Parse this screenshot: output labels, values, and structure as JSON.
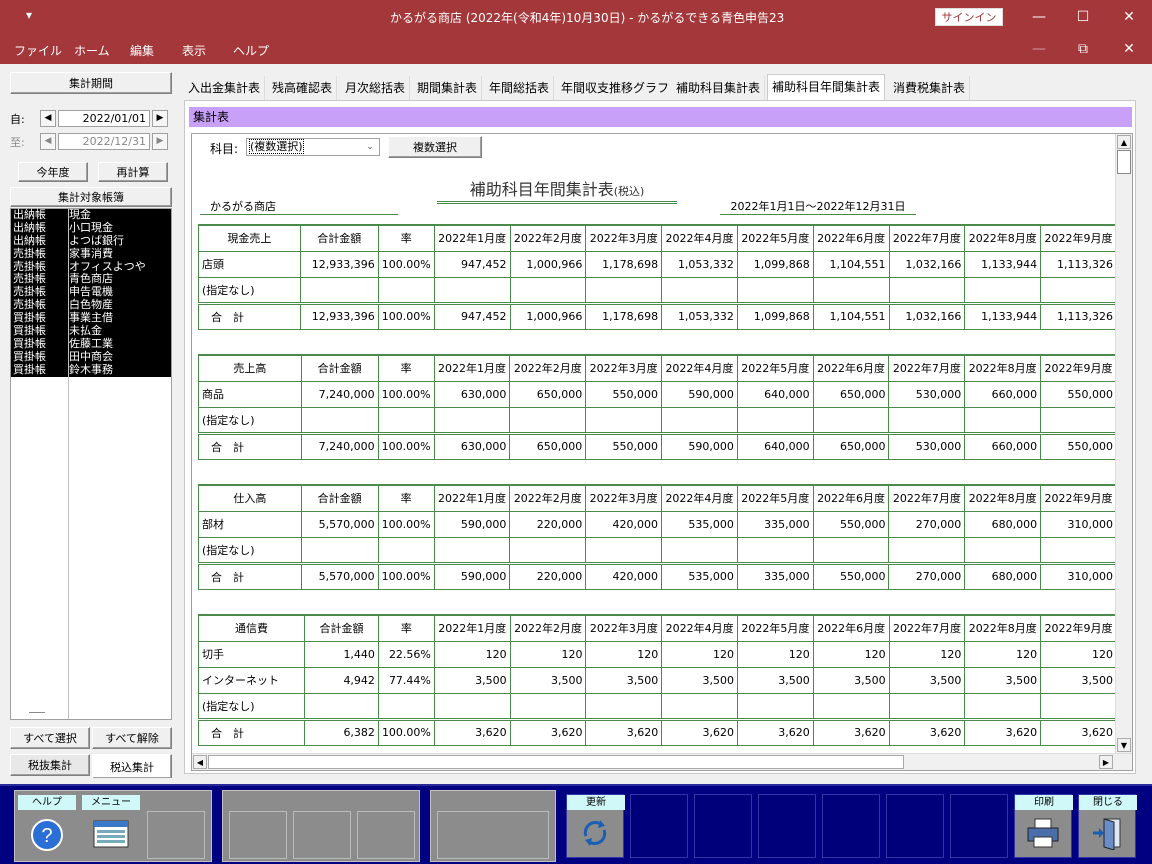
{
  "window": {
    "title": "かるがる商店 (2022年(令和4年)10月30日)  -  かるがるできる青色申告23",
    "signin_label": "サインイン",
    "menu_glyph": "▾"
  },
  "menu": [
    "ファイル",
    "ホーム",
    "編集",
    "表示",
    "ヘルプ"
  ],
  "left_panel": {
    "period_button": "集計期間",
    "from_label": "自:",
    "from_date": "2022/01/01",
    "to_label": "至:",
    "to_date": "2022/12/31",
    "this_year_button": "今年度",
    "recalc_button": "再計算",
    "target_ledger_header": "集計対象帳簿",
    "ledgers": [
      {
        "book": "出納帳",
        "name": "現金"
      },
      {
        "book": "出納帳",
        "name": "小口現金"
      },
      {
        "book": "出納帳",
        "name": "よつば銀行"
      },
      {
        "book": "売掛帳",
        "name": "家事消費"
      },
      {
        "book": "売掛帳",
        "name": "オフィスよつや"
      },
      {
        "book": "売掛帳",
        "name": "青色商店"
      },
      {
        "book": "売掛帳",
        "name": "申告電機"
      },
      {
        "book": "売掛帳",
        "name": "白色物産"
      },
      {
        "book": "買掛帳",
        "name": "事業主借"
      },
      {
        "book": "買掛帳",
        "name": "未払金"
      },
      {
        "book": "買掛帳",
        "name": "佐藤工業"
      },
      {
        "book": "買掛帳",
        "name": "田中商会"
      },
      {
        "book": "買掛帳",
        "name": "鈴木事務"
      }
    ],
    "select_all_button": "すべて選択",
    "deselect_all_button": "すべて解除",
    "tax_excl_button": "税抜集計",
    "tax_incl_button": "税込集計"
  },
  "tabs": [
    "入出金集計表",
    "残高確認表",
    "月次総括表",
    "期間集計表",
    "年間総括表",
    "年間収支推移グラフ",
    "補助科目集計表",
    "補助科目年間集計表",
    "消費税集計表"
  ],
  "active_tab": "補助科目年間集計表",
  "section_label": "集計表",
  "filter": {
    "label": "科目:",
    "value": "(複数選択)",
    "multi_button": "複数選択"
  },
  "report": {
    "title": "補助科目年間集計表",
    "title_suffix": "(税込)",
    "company": "かるがる商店",
    "period": "2022年1月1日～2022年12月31日",
    "col_total": "合計金額",
    "col_rate": "率",
    "months": [
      "2022年1月度",
      "2022年2月度",
      "2022年3月度",
      "2022年4月度",
      "2022年5月度",
      "2022年6月度",
      "2022年7月度",
      "2022年8月度",
      "2022年9月度"
    ],
    "sections": [
      {
        "account": "現金売上",
        "rows": [
          {
            "name": "店頭",
            "total": "12,933,396",
            "rate": "100.00%",
            "values": [
              "947,452",
              "1,000,966",
              "1,178,698",
              "1,053,332",
              "1,099,868",
              "1,104,551",
              "1,032,166",
              "1,133,944",
              "1,113,326"
            ]
          },
          {
            "name": "(指定なし)",
            "total": "",
            "rate": "",
            "values": [
              "",
              "",
              "",
              "",
              "",
              "",
              "",
              "",
              ""
            ]
          }
        ],
        "sum": {
          "name": "合　計",
          "total": "12,933,396",
          "rate": "100.00%",
          "values": [
            "947,452",
            "1,000,966",
            "1,178,698",
            "1,053,332",
            "1,099,868",
            "1,104,551",
            "1,032,166",
            "1,133,944",
            "1,113,326"
          ]
        }
      },
      {
        "account": "売上高",
        "rows": [
          {
            "name": "商品",
            "total": "7,240,000",
            "rate": "100.00%",
            "values": [
              "630,000",
              "650,000",
              "550,000",
              "590,000",
              "640,000",
              "650,000",
              "530,000",
              "660,000",
              "550,000"
            ]
          },
          {
            "name": "(指定なし)",
            "total": "",
            "rate": "",
            "values": [
              "",
              "",
              "",
              "",
              "",
              "",
              "",
              "",
              ""
            ]
          }
        ],
        "sum": {
          "name": "合　計",
          "total": "7,240,000",
          "rate": "100.00%",
          "values": [
            "630,000",
            "650,000",
            "550,000",
            "590,000",
            "640,000",
            "650,000",
            "530,000",
            "660,000",
            "550,000"
          ]
        }
      },
      {
        "account": "仕入高",
        "rows": [
          {
            "name": "部材",
            "total": "5,570,000",
            "rate": "100.00%",
            "values": [
              "590,000",
              "220,000",
              "420,000",
              "535,000",
              "335,000",
              "550,000",
              "270,000",
              "680,000",
              "310,000"
            ]
          },
          {
            "name": "(指定なし)",
            "total": "",
            "rate": "",
            "values": [
              "",
              "",
              "",
              "",
              "",
              "",
              "",
              "",
              ""
            ]
          }
        ],
        "sum": {
          "name": "合　計",
          "total": "5,570,000",
          "rate": "100.00%",
          "values": [
            "590,000",
            "220,000",
            "420,000",
            "535,000",
            "335,000",
            "550,000",
            "270,000",
            "680,000",
            "310,000"
          ]
        }
      },
      {
        "account": "通信費",
        "rows": [
          {
            "name": "切手",
            "total": "1,440",
            "rate": "22.56%",
            "values": [
              "120",
              "120",
              "120",
              "120",
              "120",
              "120",
              "120",
              "120",
              "120"
            ]
          },
          {
            "name": "インターネット",
            "total": "4,942",
            "rate": "77.44%",
            "values": [
              "3,500",
              "3,500",
              "3,500",
              "3,500",
              "3,500",
              "3,500",
              "3,500",
              "3,500",
              "3,500"
            ]
          },
          {
            "name": "(指定なし)",
            "total": "",
            "rate": "",
            "values": [
              "",
              "",
              "",
              "",
              "",
              "",
              "",
              "",
              ""
            ]
          }
        ],
        "sum": {
          "name": "合　計",
          "total": "6,382",
          "rate": "100.00%",
          "values": [
            "3,620",
            "3,620",
            "3,620",
            "3,620",
            "3,620",
            "3,620",
            "3,620",
            "3,620",
            "3,620"
          ]
        }
      }
    ]
  },
  "function_keys": {
    "help": "ヘルプ",
    "menu": "メニュー",
    "refresh": "更新",
    "print": "印刷",
    "close": "閉じる"
  }
}
